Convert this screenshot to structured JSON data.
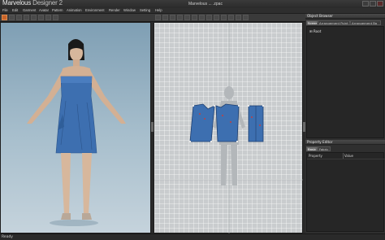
{
  "app": {
    "brand": "Marvelous",
    "product": "Designer 2",
    "document_title": "Marvelous ... .zpac"
  },
  "menu": [
    "File",
    "Edit",
    "Garment",
    "Avatar",
    "Pattern",
    "Animation",
    "Environment",
    "Render",
    "Window",
    "Setting",
    "Help"
  ],
  "toolbar": {
    "icons": [
      "select-icon",
      "move-icon",
      "rotate-icon",
      "tack-icon",
      "pin-icon",
      "fold-icon",
      "mesh-icon",
      "simulate-icon",
      "record-icon",
      "play-icon"
    ]
  },
  "object_browser": {
    "title": "Object Browser",
    "tabs": [
      "Scene",
      "Arrangement Point",
      "Arrangement Bo"
    ],
    "tree": [
      "Root"
    ]
  },
  "property_editor": {
    "title": "Property Editor",
    "tabs": [
      "Basic",
      "Fabric"
    ],
    "columns": [
      "Property",
      "Value"
    ]
  },
  "status": "Ready",
  "colors": {
    "dress": "#3d6fb0",
    "accent": "#c8642a"
  }
}
